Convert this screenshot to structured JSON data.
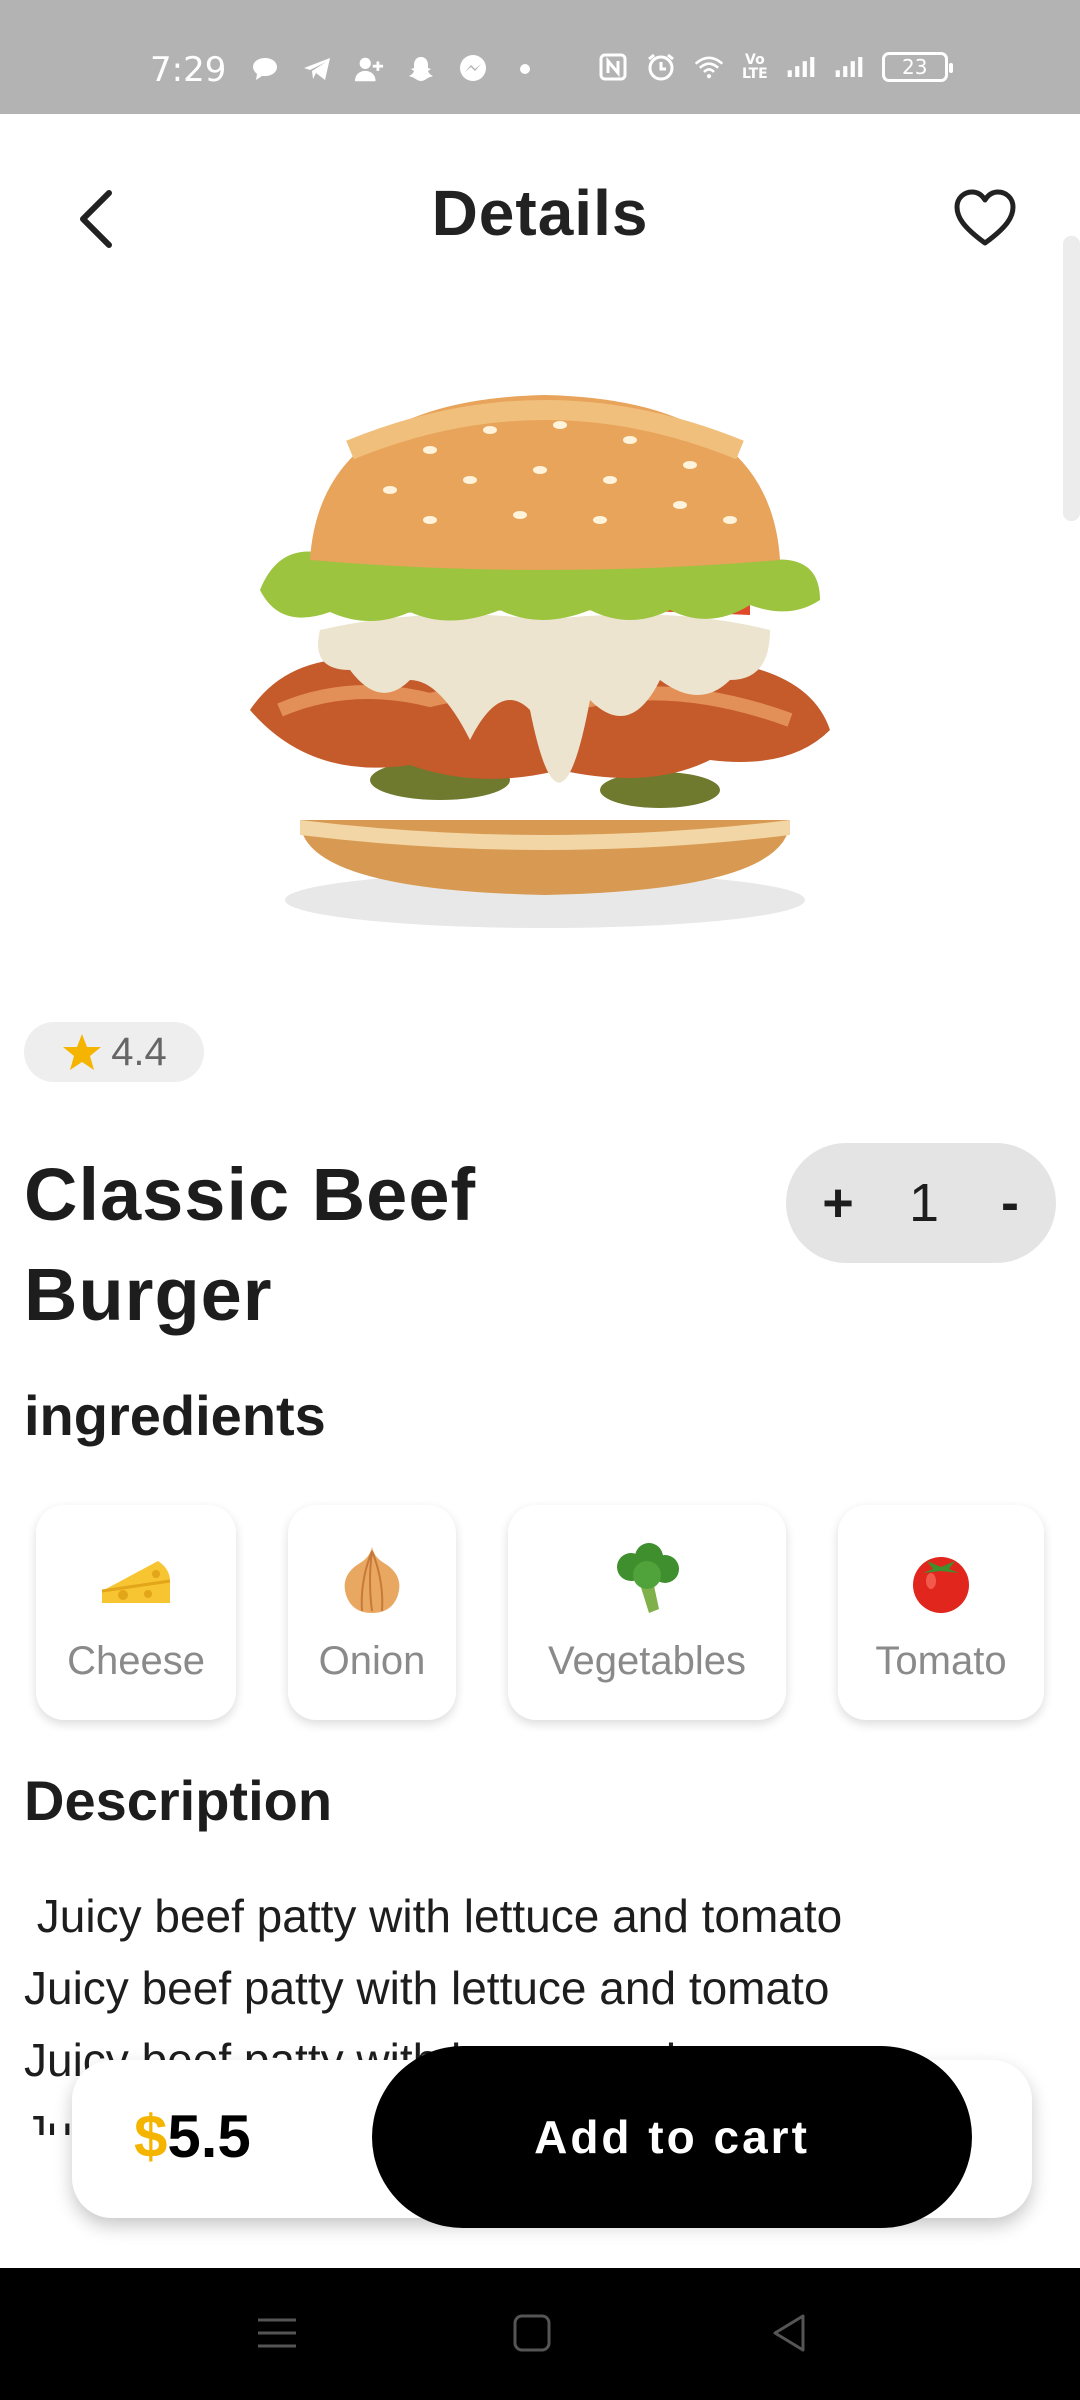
{
  "status_bar": {
    "time": "7:29",
    "volte_text": "Vo\nLTE",
    "battery": "23"
  },
  "header": {
    "title": "Details"
  },
  "product": {
    "rating": "4.4",
    "name": "Classic Beef Burger",
    "quantity": "1",
    "plus_label": "+",
    "minus_label": "-"
  },
  "ingredients": {
    "title": "ingredients",
    "items": [
      {
        "label": "Cheese",
        "icon": "cheese-icon"
      },
      {
        "label": "Onion",
        "icon": "onion-icon"
      },
      {
        "label": "Vegetables",
        "icon": "broccoli-icon"
      },
      {
        "label": "Tomato",
        "icon": "tomato-icon"
      }
    ]
  },
  "description": {
    "title": "Description",
    "text": " Juicy beef patty with lettuce and tomato\nJuicy beef patty with lettuce and tomato\nJuicy beef patty with lettuce and tomato\nJuicy beef patty with lettuce and tomato"
  },
  "cart": {
    "currency": "$",
    "price": "5.5",
    "add_label": "Add to cart"
  },
  "colors": {
    "accent": "#f5b400",
    "primary": "#000000",
    "status_bar": "#b3b3b3"
  }
}
